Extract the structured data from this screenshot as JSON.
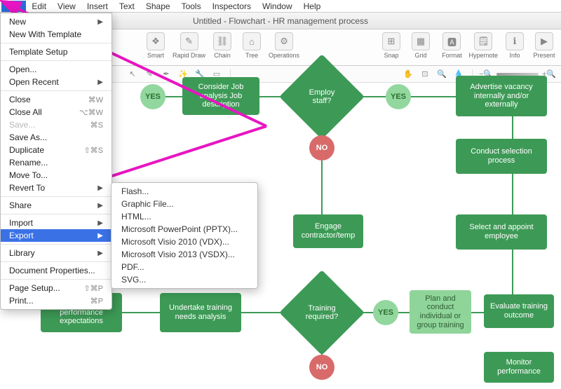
{
  "menubar": [
    "File",
    "Edit",
    "View",
    "Insert",
    "Text",
    "Shape",
    "Tools",
    "Inspectors",
    "Window",
    "Help"
  ],
  "menubar_selected": 0,
  "title": "Untitled - Flowchart - HR management process",
  "toolbar_left": [
    {
      "label": "Smart",
      "icon": "❖"
    },
    {
      "label": "Rapid Draw",
      "icon": "✎"
    },
    {
      "label": "Chain",
      "icon": "⛓"
    },
    {
      "label": "Tree",
      "icon": "⌂"
    },
    {
      "label": "Operations",
      "icon": "⚙"
    }
  ],
  "toolbar_mid": [
    {
      "label": "Snap",
      "icon": "⊞"
    },
    {
      "label": "Grid",
      "icon": "▦"
    }
  ],
  "toolbar_right": [
    {
      "label": "Format",
      "icon": "🅰"
    },
    {
      "label": "Hypernote",
      "icon": "🗒"
    },
    {
      "label": "Info",
      "icon": "ℹ"
    },
    {
      "label": "Present",
      "icon": "▶"
    }
  ],
  "file_menu": [
    {
      "label": "New",
      "shortcut": "",
      "arrow": true
    },
    {
      "label": "New With Template",
      "shortcut": ""
    },
    {
      "type": "sep"
    },
    {
      "label": "Template Setup"
    },
    {
      "type": "sep"
    },
    {
      "label": "Open...",
      "shortcut": ""
    },
    {
      "label": "Open Recent",
      "arrow": true
    },
    {
      "type": "sep"
    },
    {
      "label": "Close",
      "shortcut": "⌘W"
    },
    {
      "label": "Close All",
      "shortcut": "⌥⌘W"
    },
    {
      "label": "Save...",
      "shortcut": "⌘S",
      "disabled": true
    },
    {
      "label": "Save As..."
    },
    {
      "label": "Duplicate",
      "shortcut": "⇧⌘S"
    },
    {
      "label": "Rename..."
    },
    {
      "label": "Move To..."
    },
    {
      "label": "Revert To",
      "arrow": true
    },
    {
      "type": "sep"
    },
    {
      "label": "Share",
      "arrow": true
    },
    {
      "type": "sep"
    },
    {
      "label": "Import",
      "arrow": true
    },
    {
      "label": "Export",
      "arrow": true,
      "hl": true
    },
    {
      "type": "sep"
    },
    {
      "label": "Library",
      "arrow": true
    },
    {
      "type": "sep"
    },
    {
      "label": "Document Properties..."
    },
    {
      "type": "sep"
    },
    {
      "label": "Page Setup...",
      "shortcut": "⇧⌘P"
    },
    {
      "label": "Print...",
      "shortcut": "⌘P"
    }
  ],
  "export_submenu": [
    {
      "label": "Flash..."
    },
    {
      "label": "Graphic File..."
    },
    {
      "label": "HTML..."
    },
    {
      "label": "Microsoft PowerPoint (PPTX)..."
    },
    {
      "label": "Microsoft Visio 2010 (VDX)..."
    },
    {
      "label": "Microsoft Visio 2013 (VSDX)...",
      "hl": true
    },
    {
      "label": "PDF..."
    },
    {
      "label": "SVG..."
    }
  ],
  "flow": {
    "yes1": "YES",
    "yes2": "YES",
    "yes3": "YES",
    "no1": "NO",
    "no2": "NO",
    "consider": "Consider Job analysis Job description",
    "employ": "Employ staff?",
    "advertise": "Advertise vacancy internally and/or externally",
    "selection": "Conduct selection process",
    "engage": "Engage contractor/temp",
    "appoint": "Select and appoint employee",
    "process": "process",
    "setgoals": "Set goals and performance expectations",
    "undertake": "Undertake training needs analysis",
    "training": "Training required?",
    "plan": "Plan and conduct individual or group training",
    "evaluate": "Evaluate training outcome",
    "monitor": "Monitor performance"
  }
}
